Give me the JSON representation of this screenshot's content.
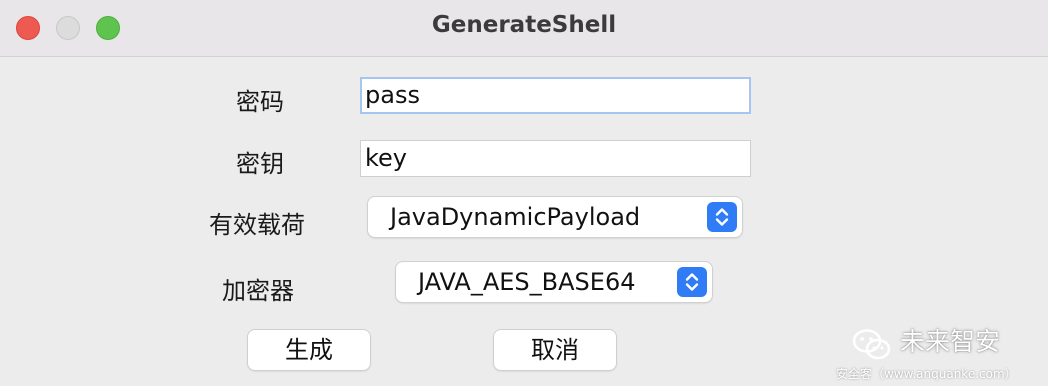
{
  "window": {
    "title": "GenerateShell"
  },
  "form": {
    "password": {
      "label": "密码",
      "value": "pass"
    },
    "key": {
      "label": "密钥",
      "value": "key"
    },
    "payload": {
      "label": "有效载荷",
      "selected": "JavaDynamicPayload"
    },
    "cryption": {
      "label": "加密器",
      "selected": "JAVA_AES_BASE64"
    }
  },
  "buttons": {
    "generate_label": "生成",
    "cancel_label": "取消"
  },
  "watermark": {
    "name": "未来智安",
    "site": "安全客（www.anquanke.com）"
  },
  "colors": {
    "close": "#ee5a52",
    "minimize": "#dcdcdc",
    "maximize": "#5ec44f",
    "accent": "#2f7cf6",
    "focus_ring": "#a5c6ee"
  },
  "icons": {
    "stepper": "up-down-chevron-icon",
    "watermark_logo": "wechat-icon"
  }
}
